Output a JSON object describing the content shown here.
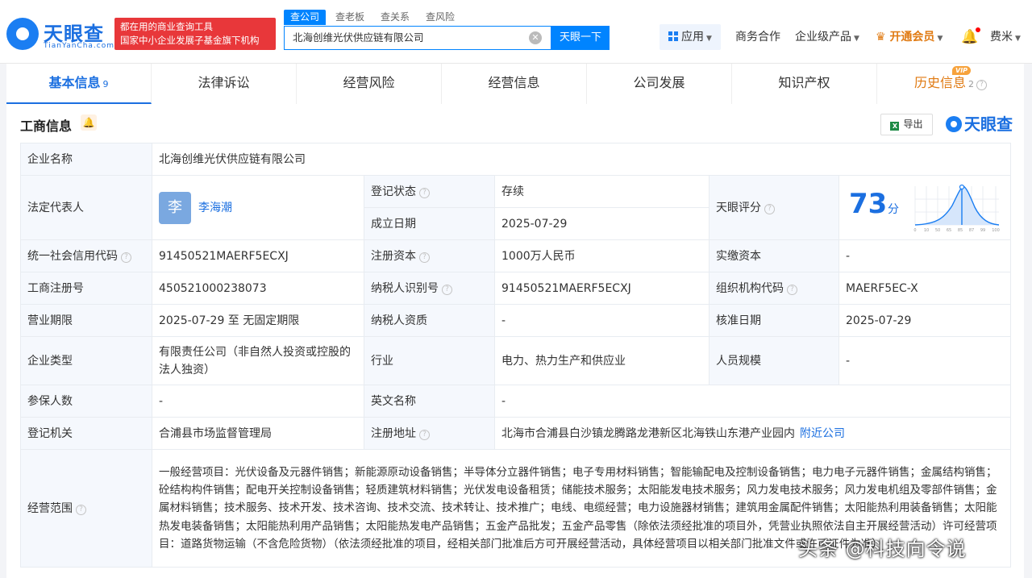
{
  "header": {
    "logo_cn": "天眼查",
    "logo_en": "TianYanCha.com",
    "slogan_line1": "都在用的商业查询工具",
    "slogan_line2": "国家中小企业发展子基金旗下机构",
    "search_tabs": [
      "查公司",
      "查老板",
      "查关系",
      "查风险"
    ],
    "search_value": "北海创维光伏供应链有限公司",
    "search_button": "天眼一下",
    "nav": {
      "apps": "应用",
      "business": "商务合作",
      "enterprise": "企业级产品",
      "vip": "开通会员",
      "user": "费米"
    }
  },
  "tabs": [
    {
      "label": "基本信息",
      "count": "9"
    },
    {
      "label": "法律诉讼",
      "count": ""
    },
    {
      "label": "经营风险",
      "count": ""
    },
    {
      "label": "经营信息",
      "count": ""
    },
    {
      "label": "公司发展",
      "count": ""
    },
    {
      "label": "知识产权",
      "count": ""
    },
    {
      "label": "历史信息",
      "count": "2"
    }
  ],
  "vip_badge": "VIP",
  "section": {
    "title": "工商信息",
    "export": "导出",
    "brand": "天眼查"
  },
  "info": {
    "company_name_label": "企业名称",
    "company_name": "北海创维光伏供应链有限公司",
    "legal_rep_label": "法定代表人",
    "legal_rep_avatar": "李",
    "legal_rep": "李海潮",
    "reg_status_label": "登记状态",
    "reg_status": "存续",
    "established_label": "成立日期",
    "established": "2025-07-29",
    "score_label": "天眼评分",
    "score": "73",
    "score_unit": "分",
    "score_ticks": [
      "0",
      "10",
      "50",
      "65",
      "85",
      "87",
      "99",
      "100"
    ],
    "credit_code_label": "统一社会信用代码",
    "credit_code": "91450521MAERF5ECXJ",
    "reg_capital_label": "注册资本",
    "reg_capital": "1000万人民币",
    "paid_capital_label": "实缴资本",
    "paid_capital": "-",
    "reg_no_label": "工商注册号",
    "reg_no": "450521000238073",
    "taxpayer_id_label": "纳税人识别号",
    "taxpayer_id": "91450521MAERF5ECXJ",
    "org_code_label": "组织机构代码",
    "org_code": "MAERF5EC-X",
    "term_label": "营业期限",
    "term": "2025-07-29 至 无固定期限",
    "taxpayer_qual_label": "纳税人资质",
    "taxpayer_qual": "-",
    "approval_date_label": "核准日期",
    "approval_date": "2025-07-29",
    "type_label": "企业类型",
    "type": "有限责任公司（非自然人投资或控股的法人独资）",
    "industry_label": "行业",
    "industry": "电力、热力生产和供应业",
    "staff_size_label": "人员规模",
    "staff_size": "-",
    "insured_label": "参保人数",
    "insured": "-",
    "english_name_label": "英文名称",
    "english_name": "-",
    "authority_label": "登记机关",
    "authority": "合浦县市场监督管理局",
    "address_label": "注册地址",
    "address": "北海市合浦县白沙镇龙腾路龙港新区北海铁山东港产业园内",
    "nearby_link": "附近公司",
    "scope_label": "经营范围",
    "scope": "一般经营项目：光伏设备及元器件销售；新能源原动设备销售；半导体分立器件销售；电子专用材料销售；智能输配电及控制设备销售；电力电子元器件销售；金属结构销售；砼结构构件销售；配电开关控制设备销售；轻质建筑材料销售；光伏发电设备租赁；储能技术服务；太阳能发电技术服务；风力发电技术服务；风力发电机组及零部件销售；金属材料销售；技术服务、技术开发、技术咨询、技术交流、技术转让、技术推广；电线、电缆经营；电力设施器材销售；建筑用金属配件销售；太阳能热利用装备销售；太阳能热发电装备销售；太阳能热利用产品销售；太阳能热发电产品销售；五金产品批发；五金产品零售（除依法须经批准的项目外，凭营业执照依法自主开展经营活动）许可经营项目：道路货物运输（不含危险货物）（依法须经批准的项目，经相关部门批准后方可开展经营活动，具体经营项目以相关部门批准文件或许可证件为准）"
  },
  "watermark": "头条 @科技向令说",
  "colors": {
    "brand_blue": "#1b6fe0",
    "search_blue": "#0084ff",
    "slogan_red": "#e8373a",
    "status_green": "#1d9b4d",
    "vip_orange": "#e07a12"
  }
}
